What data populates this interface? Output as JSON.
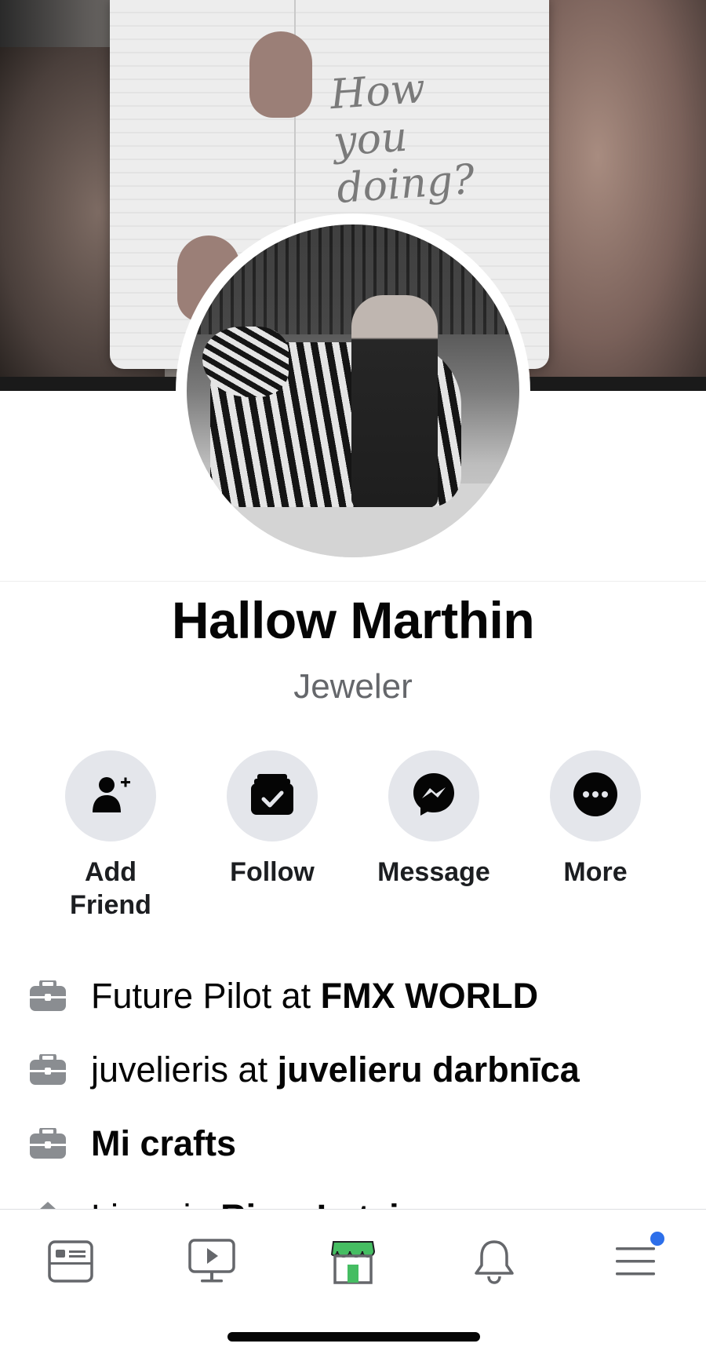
{
  "profile": {
    "name": "Hallow Marthin",
    "title": "Jeweler"
  },
  "cover": {
    "handwriting": "How you doing?"
  },
  "actions": [
    {
      "label": "Add Friend",
      "icon": "add-friend-icon"
    },
    {
      "label": "Follow",
      "icon": "follow-icon"
    },
    {
      "label": "Message",
      "icon": "messenger-icon"
    },
    {
      "label": "More",
      "icon": "more-icon"
    }
  ],
  "details": [
    {
      "prefix": "Future Pilot at ",
      "bold": "FMX WORLD",
      "icon": "briefcase-icon"
    },
    {
      "prefix": "juvelieris at ",
      "bold": "juvelieru darbnīca",
      "icon": "briefcase-icon"
    },
    {
      "prefix": "",
      "bold": "Mi crafts",
      "icon": "briefcase-icon"
    },
    {
      "prefix": "Lives in ",
      "bold": "Riga, Latvia",
      "icon": "home-icon"
    }
  ],
  "tabbar": {
    "items": [
      {
        "name": "news-feed",
        "icon": "news-feed-icon"
      },
      {
        "name": "watch",
        "icon": "watch-icon"
      },
      {
        "name": "marketplace",
        "icon": "marketplace-icon",
        "active": true
      },
      {
        "name": "notifications",
        "icon": "bell-icon"
      },
      {
        "name": "menu",
        "icon": "menu-icon",
        "badge": true
      }
    ]
  },
  "colors": {
    "accent_blue": "#2d6fea",
    "marketplace_green": "#45bd62",
    "secondary_text": "#65676b",
    "button_bg": "#e4e6eb"
  }
}
